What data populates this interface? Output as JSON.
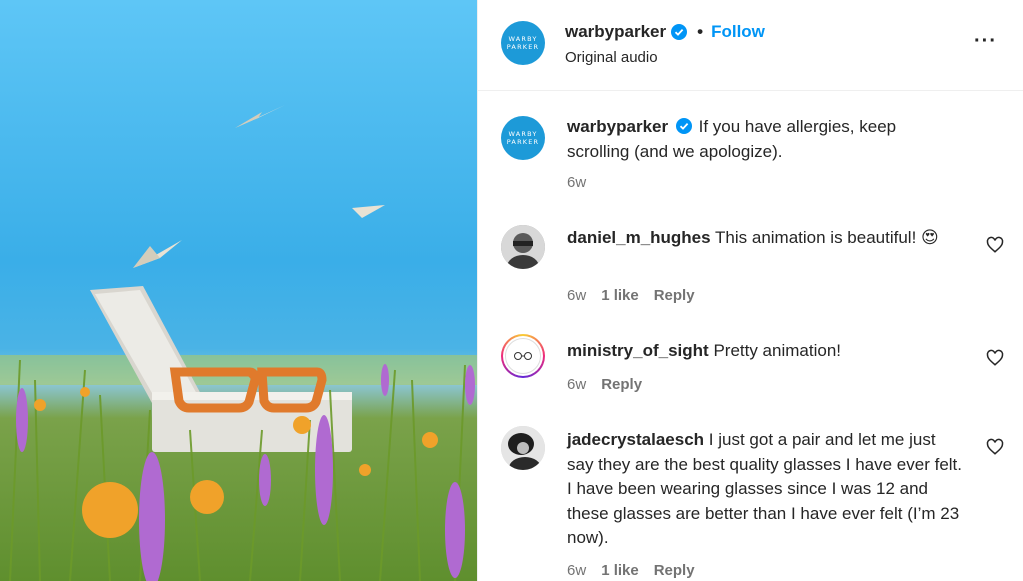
{
  "post": {
    "username": "warbyparker",
    "follow_label": "Follow",
    "audio": "Original audio",
    "separator": "•",
    "more_icon": "more-horizontal-icon",
    "brand_logo_lines": [
      "WARBY",
      "PARKER"
    ],
    "brand_color": "#1d9ad8",
    "link_color": "#0095f6"
  },
  "caption": {
    "username": "warbyparker",
    "text": "If you have allergies, keep scrolling (and we apologize).",
    "time": "6w"
  },
  "comments": [
    {
      "username": "daniel_m_hughes",
      "text": "This animation is beautiful! 😍",
      "time": "6w",
      "likes": "1 like",
      "reply": "Reply"
    },
    {
      "username": "ministry_of_sight",
      "text": "Pretty animation!",
      "time": "6w",
      "reply": "Reply"
    },
    {
      "username": "jadecrystalaesch",
      "text": "I just got a pair and let me just say they are the best quality glasses I have ever felt. I have been wearing glasses since I was 12 and these glasses are better than I have ever felt (I’m 23 now).",
      "time": "6w",
      "likes": "1 like",
      "reply": "Reply"
    }
  ]
}
